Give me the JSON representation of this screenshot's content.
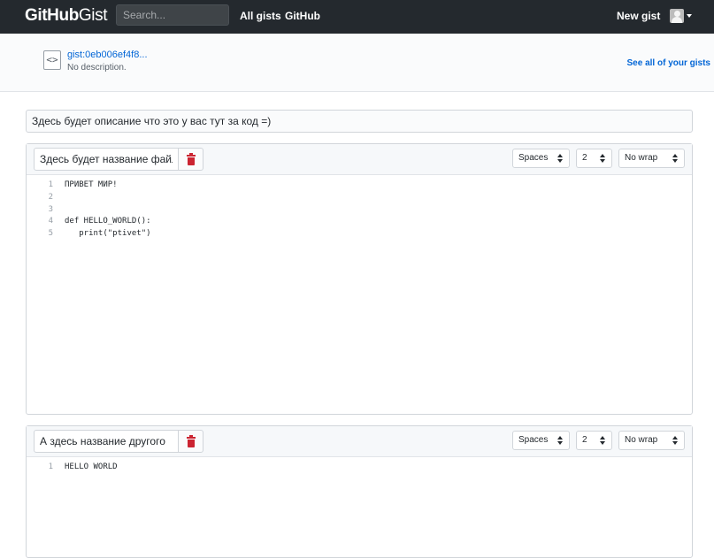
{
  "header": {
    "logo_hub": "GitHub",
    "logo_gist": "Gist",
    "search_placeholder": "Search...",
    "nav": [
      "All gists",
      "GitHub"
    ],
    "new_gist": "New gist",
    "avatar_icon": "user-avatar-icon",
    "menu_icon": "caret-down-icon"
  },
  "gist": {
    "icon": "code-icon",
    "icon_glyph": "<>",
    "id": "gist:0eb006ef4f8...",
    "description_status": "No description.",
    "see_all": "See all of your gists"
  },
  "editor": {
    "description_value": "Здесь будет описание что это у вас тут за код =)",
    "files": [
      {
        "filename": "Здесь будет название файла",
        "delete_icon": "trash-icon",
        "indent_mode": "Spaces",
        "indent_size": "2",
        "wrap_mode": "No wrap",
        "lines": [
          {
            "n": "1",
            "text": "ПРИВЕТ МИР!"
          },
          {
            "n": "2",
            "text": ""
          },
          {
            "n": "3",
            "text": ""
          },
          {
            "n": "4",
            "text": "def HELLO_WORLD():"
          },
          {
            "n": "5",
            "text": "   print(\"ptivet\")"
          }
        ]
      },
      {
        "filename": "А здесь название другого",
        "delete_icon": "trash-icon",
        "indent_mode": "Spaces",
        "indent_size": "2",
        "wrap_mode": "No wrap",
        "lines": [
          {
            "n": "1",
            "text": "HELLO WORLD"
          }
        ]
      }
    ]
  },
  "colors": {
    "header_bg": "#24292e",
    "link": "#0366d6",
    "danger": "#cb2431"
  }
}
